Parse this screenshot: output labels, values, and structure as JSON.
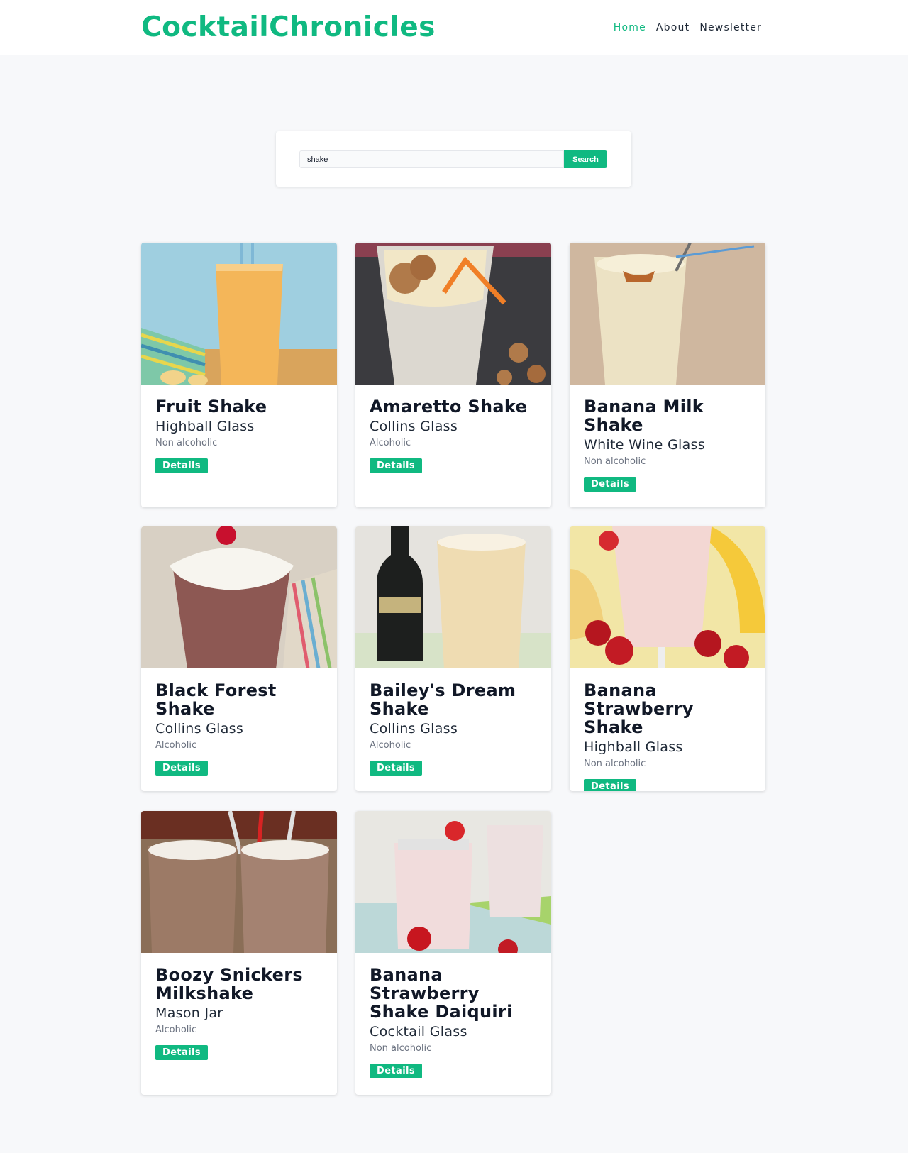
{
  "header": {
    "brand": "CocktailChronicles",
    "nav": [
      {
        "label": "Home",
        "active": true
      },
      {
        "label": "About",
        "active": false
      },
      {
        "label": "Newsletter",
        "active": false
      }
    ]
  },
  "search": {
    "value": "shake",
    "button_label": "Search"
  },
  "colors": {
    "accent": "#10b981",
    "background": "#f7f8fa"
  },
  "cards": [
    {
      "title": "Fruit Shake",
      "glass": "Highball Glass",
      "alcoholic": "Non alcoholic",
      "button": "Details"
    },
    {
      "title": "Amaretto Shake",
      "glass": "Collins Glass",
      "alcoholic": "Alcoholic",
      "button": "Details"
    },
    {
      "title": "Banana Milk Shake",
      "glass": "White Wine Glass",
      "alcoholic": "Non alcoholic",
      "button": "Details"
    },
    {
      "title": "Black Forest Shake",
      "glass": "Collins Glass",
      "alcoholic": "Alcoholic",
      "button": "Details"
    },
    {
      "title": "Bailey's Dream Shake",
      "glass": "Collins Glass",
      "alcoholic": "Alcoholic",
      "button": "Details"
    },
    {
      "title": "Banana Strawberry Shake",
      "glass": "Highball Glass",
      "alcoholic": "Non alcoholic",
      "button": "Details"
    },
    {
      "title": "Boozy Snickers Milkshake",
      "glass": "Mason Jar",
      "alcoholic": "Alcoholic",
      "button": "Details"
    },
    {
      "title": "Banana Strawberry Shake Daiquiri",
      "glass": "Cocktail Glass",
      "alcoholic": "Non alcoholic",
      "button": "Details"
    }
  ]
}
